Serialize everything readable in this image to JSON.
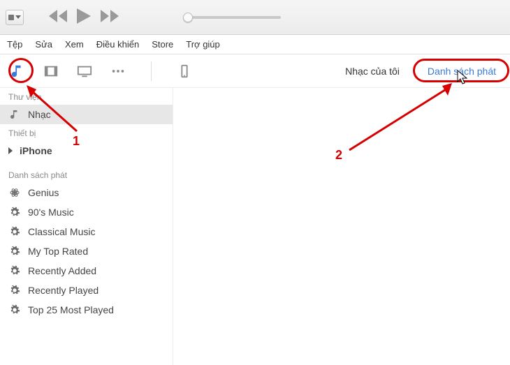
{
  "menu": {
    "file": "Tệp",
    "edit": "Sửa",
    "view": "Xem",
    "controls": "Điều khiển",
    "store": "Store",
    "help": "Trợ giúp"
  },
  "rightTabs": {
    "myMusic": "Nhạc của tôi",
    "playlists": "Danh sách phát"
  },
  "sidebar": {
    "sections": {
      "library": "Thư viện",
      "devices": "Thiết bị",
      "playlists": "Danh sách phát"
    },
    "library": {
      "music": "Nhạc"
    },
    "device": {
      "iphone": "iPhone"
    },
    "playlists": {
      "genius": "Genius",
      "nineties": "90's Music",
      "classical": "Classical Music",
      "topRated": "My Top Rated",
      "recentlyAdded": "Recently Added",
      "recentlyPlayed": "Recently Played",
      "top25": "Top 25 Most Played"
    }
  },
  "annotations": {
    "label1": "1",
    "label2": "2"
  }
}
